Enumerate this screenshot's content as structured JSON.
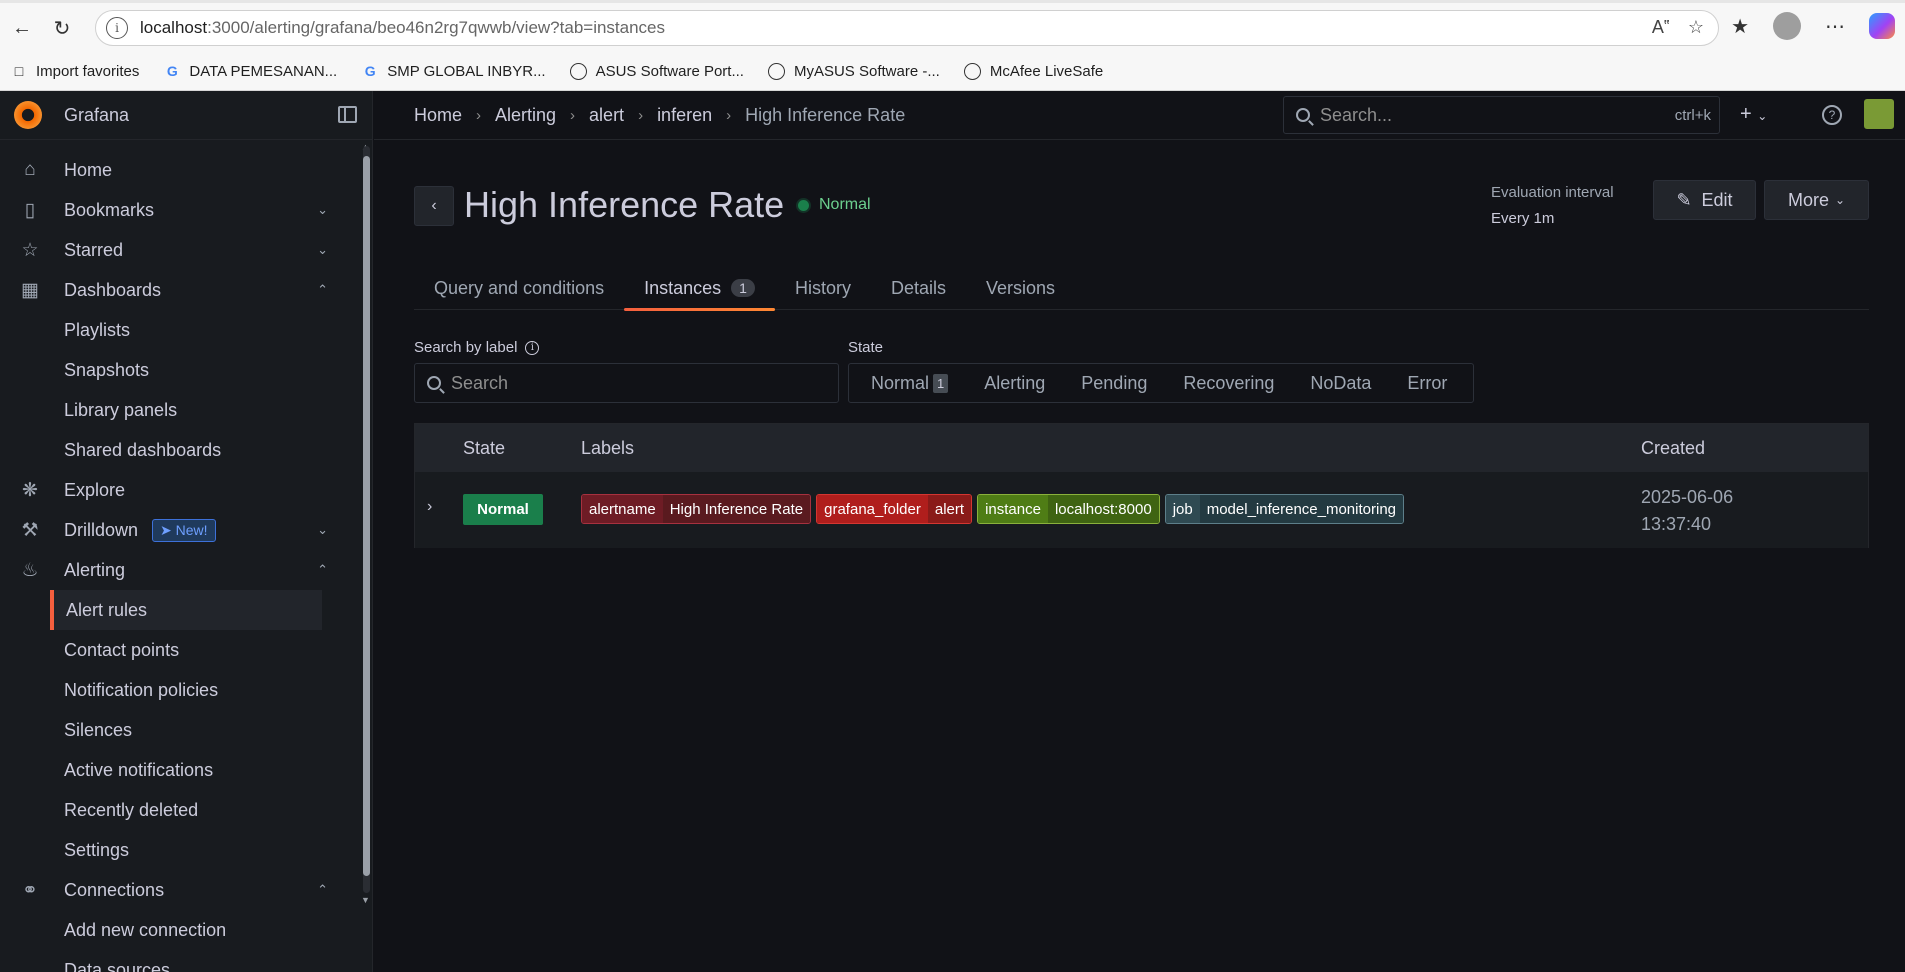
{
  "browser": {
    "url_host": "localhost",
    "url_rest": ":3000/alerting/grafana/beo46n2rg7qwwb/view?tab=instances",
    "bookmarks": [
      {
        "label": "Import favorites",
        "icon": "folder-import-icon"
      },
      {
        "label": "DATA PEMESANAN...",
        "icon": "google-icon"
      },
      {
        "label": "SMP GLOBAL INBYR...",
        "icon": "google-icon"
      },
      {
        "label": "ASUS Software Port...",
        "icon": "globe-icon"
      },
      {
        "label": "MyASUS Software -...",
        "icon": "globe-icon"
      },
      {
        "label": "McAfee LiveSafe",
        "icon": "globe-icon"
      }
    ]
  },
  "app": {
    "brand": "Grafana",
    "nav": {
      "home": "Home",
      "bookmarks": "Bookmarks",
      "starred": "Starred",
      "dashboards": "Dashboards",
      "playlists": "Playlists",
      "snapshots": "Snapshots",
      "library_panels": "Library panels",
      "shared_dashboards": "Shared dashboards",
      "explore": "Explore",
      "drilldown": "Drilldown",
      "new_badge": "New!",
      "alerting": "Alerting",
      "alert_rules": "Alert rules",
      "contact_points": "Contact points",
      "notification_policies": "Notification policies",
      "silences": "Silences",
      "active_notifications": "Active notifications",
      "recently_deleted": "Recently deleted",
      "settings": "Settings",
      "connections": "Connections",
      "add_new_connection": "Add new connection",
      "data_sources": "Data sources"
    },
    "breadcrumb": [
      "Home",
      "Alerting",
      "alert",
      "inferen",
      "High Inference Rate"
    ],
    "search": {
      "placeholder": "Search...",
      "shortcut": "ctrl+k"
    }
  },
  "rule": {
    "title": "High Inference Rate",
    "state": "Normal",
    "eval_label": "Evaluation interval",
    "eval_value": "Every 1m",
    "edit_label": "Edit",
    "more_label": "More",
    "tabs": {
      "query": "Query and conditions",
      "instances": "Instances",
      "instances_count": "1",
      "history": "History",
      "details": "Details",
      "versions": "Versions"
    },
    "filters": {
      "search_label": "Search by label",
      "search_placeholder": "Search",
      "state_label": "State",
      "states": {
        "normal": "Normal",
        "normal_count": "1",
        "alerting": "Alerting",
        "pending": "Pending",
        "recovering": "Recovering",
        "nodata": "NoData",
        "error": "Error"
      }
    },
    "table": {
      "headers": {
        "state": "State",
        "labels": "Labels",
        "created": "Created"
      },
      "row": {
        "state": "Normal",
        "labels": [
          {
            "key": "alertname",
            "value": "High Inference Rate"
          },
          {
            "key": "grafana_folder",
            "value": "alert"
          },
          {
            "key": "instance",
            "value": "localhost:8000"
          },
          {
            "key": "job",
            "value": "model_inference_monitoring"
          }
        ],
        "created_date": "2025-06-06",
        "created_time": "13:37:40"
      }
    }
  }
}
